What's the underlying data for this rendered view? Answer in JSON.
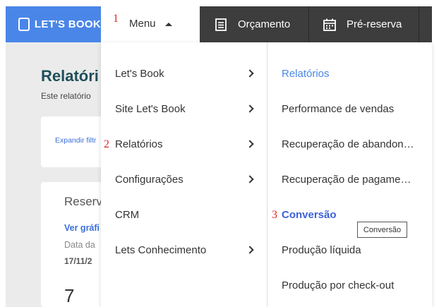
{
  "background": {
    "page_title": "Relatóri",
    "page_subtitle": "Este relatório",
    "expand_filters": "Expandir filtr",
    "card_title": "Reserv",
    "view_chart": "Ver gráfi",
    "date_label": "Data da",
    "date_value": "17/11/2",
    "count_value": "7"
  },
  "topbar": {
    "logo_text": "LET'S BOOK",
    "menu_label": "Menu",
    "nav": [
      {
        "label": "Orçamento",
        "icon": "document-icon"
      },
      {
        "label": "Pré-reserva",
        "icon": "calendar-icon"
      }
    ]
  },
  "dropdown": {
    "left_items": [
      {
        "label": "Let's Book",
        "has_submenu": true
      },
      {
        "label": "Site Let's Book",
        "has_submenu": true
      },
      {
        "label": "Relatórios",
        "has_submenu": true
      },
      {
        "label": "Configurações",
        "has_submenu": true
      },
      {
        "label": "CRM",
        "has_submenu": false
      },
      {
        "label": "Lets Conhecimento",
        "has_submenu": true
      }
    ],
    "right_header": "Relatórios",
    "right_items": [
      "Performance de vendas",
      "Recuperação de abandon…",
      "Recuperação de pagame…",
      "Conversão",
      "Produção líquida",
      "Produção por check-out"
    ]
  },
  "markers": [
    "1",
    "2",
    "3"
  ],
  "tooltip": "Conversão",
  "colors": {
    "brand_blue": "#4a86e8",
    "nav_dark": "#3d3d3d",
    "marker_red": "#e0242b",
    "active_blue": "#3d61d6"
  }
}
